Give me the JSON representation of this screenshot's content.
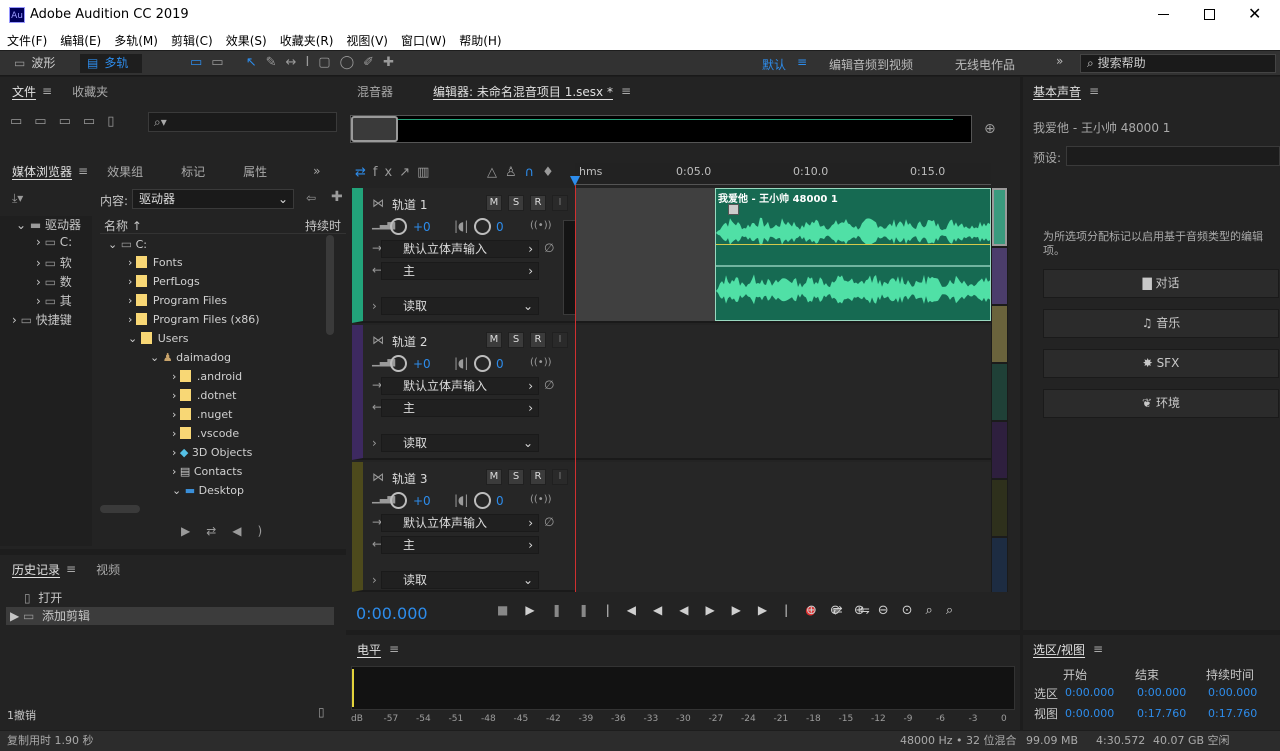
{
  "app": {
    "title": "Adobe Audition CC 2019",
    "logo": "Au"
  },
  "menu": [
    "文件(F)",
    "编辑(E)",
    "多轨(M)",
    "剪辑(C)",
    "效果(S)",
    "收藏夹(R)",
    "视图(V)",
    "窗口(W)",
    "帮助(H)"
  ],
  "toolbar": {
    "waveform": "波形",
    "multitrack": "多轨",
    "workspaces": [
      "默认",
      "编辑音频到视频",
      "无线电作品"
    ],
    "search_placeholder": "搜索帮助"
  },
  "files": {
    "tab1": "文件",
    "tab2": "收藏夹"
  },
  "media": {
    "tabs": [
      "媒体浏览器",
      "效果组",
      "标记",
      "属性"
    ],
    "content_label": "内容:",
    "content_value": "驱动器",
    "col_name": "名称",
    "col_duration": "持续时",
    "left_tree": [
      "驱动器",
      "C:",
      "软",
      "数",
      "其",
      "快捷键"
    ],
    "tree": [
      "C:",
      "Fonts",
      "PerfLogs",
      "Program Files",
      "Program Files (x86)",
      "Users",
      "daimadog",
      ".android",
      ".dotnet",
      ".nuget",
      ".vscode",
      "3D Objects",
      "Contacts",
      "Desktop"
    ]
  },
  "history": {
    "tab1": "历史记录",
    "tab2": "视频",
    "items": [
      "打开",
      "添加剪辑"
    ],
    "undo": "1撤销"
  },
  "editor": {
    "tab_mixer": "混音器",
    "tab_editor": "编辑器: 未命名混音项目 1.sesx *",
    "ruler": [
      "hms",
      "0:05.0",
      "0:10.0",
      "0:15.0"
    ],
    "clip_name": "我爱他 - 王小帅 48000 1",
    "time": "0:00.000"
  },
  "tracks": [
    {
      "name": "轨道 1",
      "vol": "+0",
      "pan": "0",
      "input": "默认立体声输入",
      "output": "主",
      "mode": "读取",
      "color": "#22a37a"
    },
    {
      "name": "轨道 2",
      "vol": "+0",
      "pan": "0",
      "input": "默认立体声输入",
      "output": "主",
      "mode": "读取",
      "color": "#3d2960"
    },
    {
      "name": "轨道 3",
      "vol": "+0",
      "pan": "0",
      "input": "默认立体声输入",
      "output": "主",
      "mode": "读取",
      "color": "#4d4a1c"
    }
  ],
  "track_btns": {
    "m": "M",
    "s": "S",
    "r": "R",
    "i": "I"
  },
  "meter": {
    "title": "电平",
    "labels": [
      "dB",
      "-57",
      "-54",
      "-51",
      "-48",
      "-45",
      "-42",
      "-39",
      "-36",
      "-33",
      "-30",
      "-27",
      "-24",
      "-21",
      "-18",
      "-15",
      "-12",
      "-9",
      "-6",
      "-3",
      "0"
    ]
  },
  "essential": {
    "title": "基本声音",
    "file": "我爱他 - 王小帅 48000 1",
    "preset_label": "预设:",
    "hint": "为所选项分配标记以启用基于音频类型的编辑项。",
    "buttons": [
      "对话",
      "音乐",
      "SFX",
      "环境"
    ]
  },
  "selection": {
    "title": "选区/视图",
    "cols": [
      "开始",
      "结束",
      "持续时间"
    ],
    "rows": [
      {
        "label": "选区",
        "vals": [
          "0:00.000",
          "0:00.000",
          "0:00.000"
        ]
      },
      {
        "label": "视图",
        "vals": [
          "0:00.000",
          "0:17.760",
          "0:17.760"
        ]
      }
    ]
  },
  "status": {
    "left": "复制用时 1.90 秒",
    "rate": "48000 Hz • 32 位混合",
    "mem": "99.09 MB",
    "dur": "4:30.572",
    "disk": "40.07 GB 空闲"
  }
}
